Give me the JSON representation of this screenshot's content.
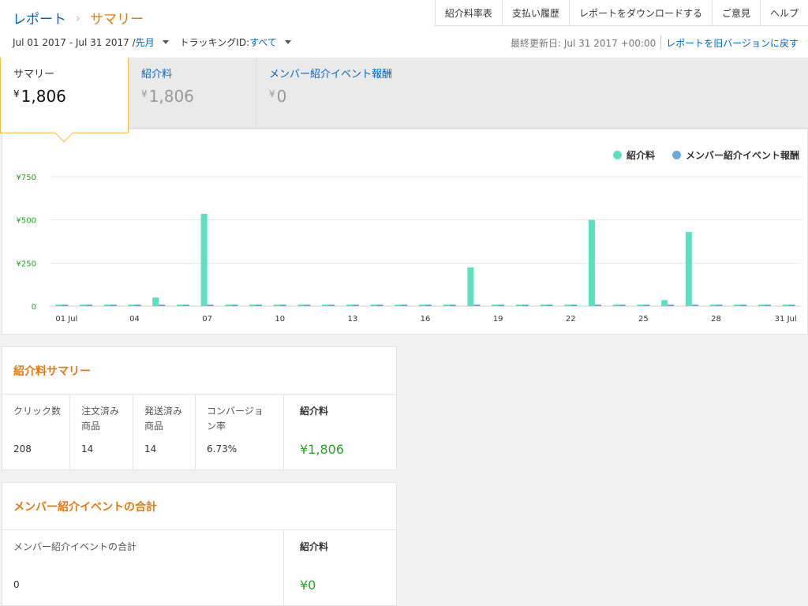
{
  "breadcrumb": {
    "parent": "レポート",
    "current": "サマリー"
  },
  "topnav": [
    "紹介料率表",
    "支払い履歴",
    "レポートをダウンロードする",
    "ご意見",
    "ヘルプ"
  ],
  "filters": {
    "date_range": "Jul 01 2017 - Jul 31 2017 / ",
    "period": "先月",
    "tracking_label": "トラッキングID: ",
    "tracking_value": "すべて"
  },
  "updated": {
    "text": "最終更新日: Jul 31 2017 +00:00",
    "revert_link": "レポートを旧バージョンに戻す"
  },
  "tabs": [
    {
      "label": "サマリー",
      "currency": "¥",
      "value": "1,806"
    },
    {
      "label": "紹介料",
      "currency": "¥",
      "value": "1,806"
    },
    {
      "label": "メンバー紹介イベント報酬",
      "currency": "¥",
      "value": "0"
    }
  ],
  "chart_data": {
    "type": "bar",
    "ylim": [
      0,
      750
    ],
    "y_ticks": [
      "¥750",
      "¥500",
      "¥250",
      "0"
    ],
    "x_tick_labels": [
      "01 Jul",
      "04",
      "07",
      "10",
      "13",
      "16",
      "19",
      "22",
      "25",
      "28",
      "31 Jul"
    ],
    "categories": [
      1,
      2,
      3,
      4,
      5,
      6,
      7,
      8,
      9,
      10,
      11,
      12,
      13,
      14,
      15,
      16,
      17,
      18,
      19,
      20,
      21,
      22,
      23,
      24,
      25,
      26,
      27,
      28,
      29,
      30,
      31
    ],
    "series": [
      {
        "name": "紹介料",
        "color": "#5ce1c0",
        "values": [
          0,
          0,
          0,
          0,
          50,
          0,
          535,
          0,
          0,
          0,
          0,
          0,
          0,
          0,
          0,
          0,
          0,
          225,
          0,
          0,
          0,
          0,
          500,
          0,
          0,
          35,
          430,
          0,
          0,
          0,
          0
        ]
      },
      {
        "name": "メンバー紹介イベント報酬",
        "color": "#6ea8dc",
        "values": [
          0,
          0,
          0,
          0,
          0,
          0,
          0,
          0,
          0,
          0,
          0,
          0,
          0,
          0,
          0,
          0,
          0,
          0,
          0,
          0,
          0,
          0,
          0,
          0,
          0,
          0,
          0,
          0,
          0,
          0,
          0
        ]
      }
    ]
  },
  "fee_summary": {
    "title": "紹介料サマリー",
    "headers": [
      "クリック数",
      "注文済み商品",
      "発送済み商品",
      "コンバージョン率",
      "紹介料"
    ],
    "values": [
      "208",
      "14",
      "14",
      "6.73%",
      "¥1,806"
    ]
  },
  "member_summary": {
    "title": "メンバー紹介イベントの合計",
    "headers": [
      "メンバー紹介イベントの合計",
      "紹介料"
    ],
    "values": [
      "0",
      "¥0"
    ]
  }
}
